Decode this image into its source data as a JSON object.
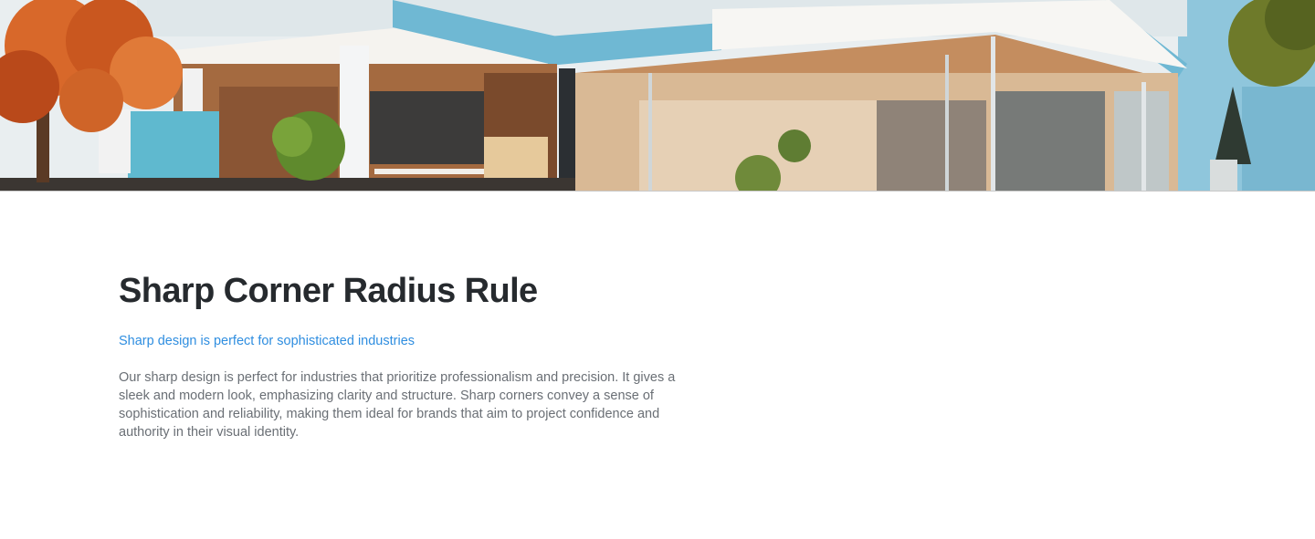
{
  "hero": {
    "image_description_icon": "modern-house-photo-icon",
    "colors": {
      "sky": "#e9eef0",
      "accent_blue": "#6fb8d3",
      "wood": "#b07a4e",
      "tree_orange": "#d8682a"
    }
  },
  "content": {
    "title": "Sharp Corner Radius Rule",
    "subtitle": "Sharp design is perfect for sophisticated industries",
    "body": "Our sharp design is perfect for industries that prioritize professionalism and precision. It gives a sleek and modern look, emphasizing clarity and structure. Sharp corners convey a sense of sophistication and reliability, making them ideal for brands that aim to project confidence and authority in their visual identity."
  },
  "colors": {
    "title": "#262a2e",
    "subtitle_link": "#2f8ee0",
    "body": "#6a6f75",
    "background": "#ffffff"
  }
}
